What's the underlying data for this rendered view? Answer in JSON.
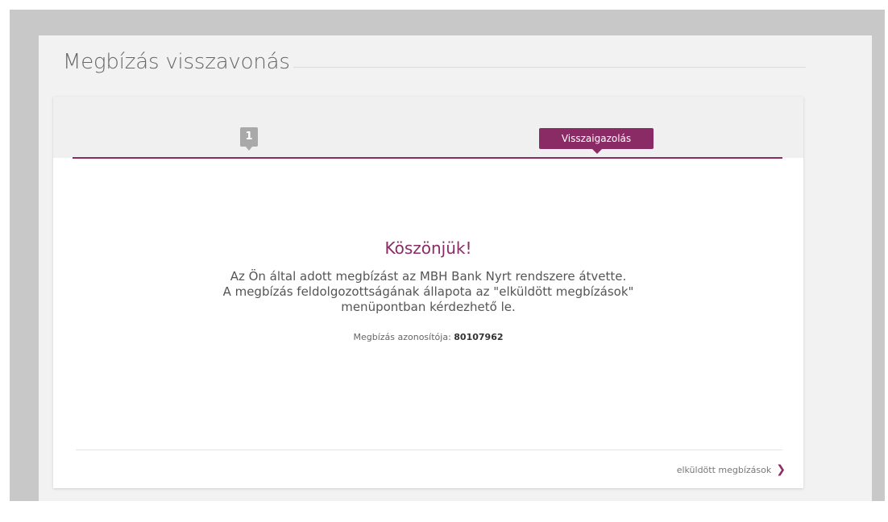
{
  "page": {
    "title": "Megbízás visszavonás"
  },
  "steps": {
    "step1_number": "1",
    "active_label": "Visszaigazolás"
  },
  "confirmation": {
    "heading": "Köszönjük!",
    "message_lines": [
      "Az Ön által adott megbízást az MBH Bank Nyrt rendszere átvette.",
      "A megbízás feldolgozottságának állapota az \"elküldött megbízások\"",
      "menüpontban kérdezhető le."
    ],
    "id_label": "Megbízás azonosítója:",
    "id_value": "80107962"
  },
  "footer": {
    "link_label": "elküldött megbízások",
    "link_icon": "chevron-right-icon"
  },
  "colors": {
    "accent": "#8b2b66",
    "step_inactive": "#a9a9a9"
  }
}
